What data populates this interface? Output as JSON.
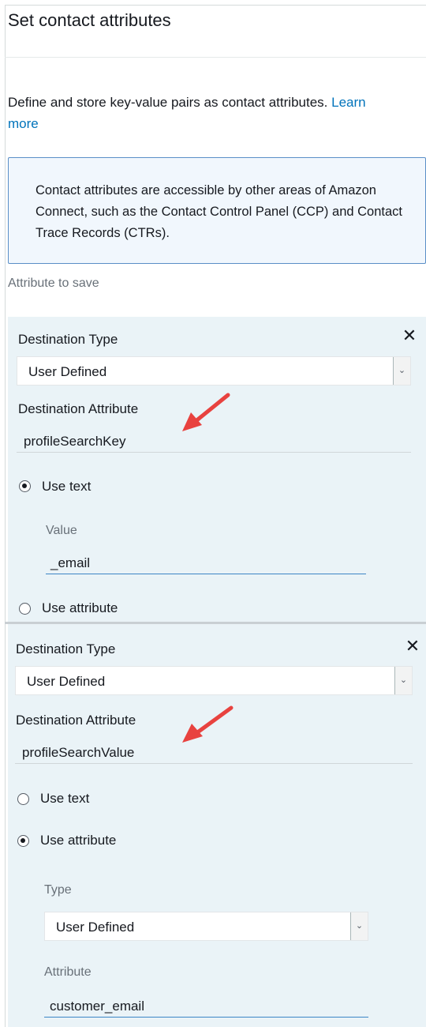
{
  "header": {
    "title": "Set contact attributes",
    "description": "Define and store key-value pairs as contact attributes.",
    "learn_more": "Learn more",
    "learn_more_line1": "Learn",
    "learn_more_line2": "more"
  },
  "info_box": {
    "text": "Contact attributes are accessible by other areas of Amazon Connect, such as the Contact Control Panel (CCP) and Contact Trace Records (CTRs)."
  },
  "attributes_section_label": "Attribute to save",
  "blocks": [
    {
      "destination_type_label": "Destination Type",
      "destination_type_value": "User Defined",
      "destination_attribute_label": "Destination Attribute",
      "destination_attribute_value": "profileSearchKey",
      "use_text_label": "Use text",
      "use_attribute_label": "Use attribute",
      "selected": "use_text",
      "value_label": "Value",
      "value": "_email"
    },
    {
      "destination_type_label": "Destination Type",
      "destination_type_value": "User Defined",
      "destination_attribute_label": "Destination Attribute",
      "destination_attribute_value": "profileSearchValue",
      "use_text_label": "Use text",
      "use_attribute_label": "Use attribute",
      "selected": "use_attribute",
      "type_label": "Type",
      "type_value": "User Defined",
      "attribute_label": "Attribute",
      "attribute_value": "customer_email"
    }
  ],
  "icons": {
    "close": "close-icon",
    "dropdown": "chevron-down-icon",
    "annotation": "red-arrow-icon"
  },
  "colors": {
    "link": "#0073bb",
    "info_bg": "#f1f7fd",
    "info_border": "#5a8fc7",
    "block_bg": "#eaf3f7",
    "annotation_arrow": "#e8423f"
  }
}
